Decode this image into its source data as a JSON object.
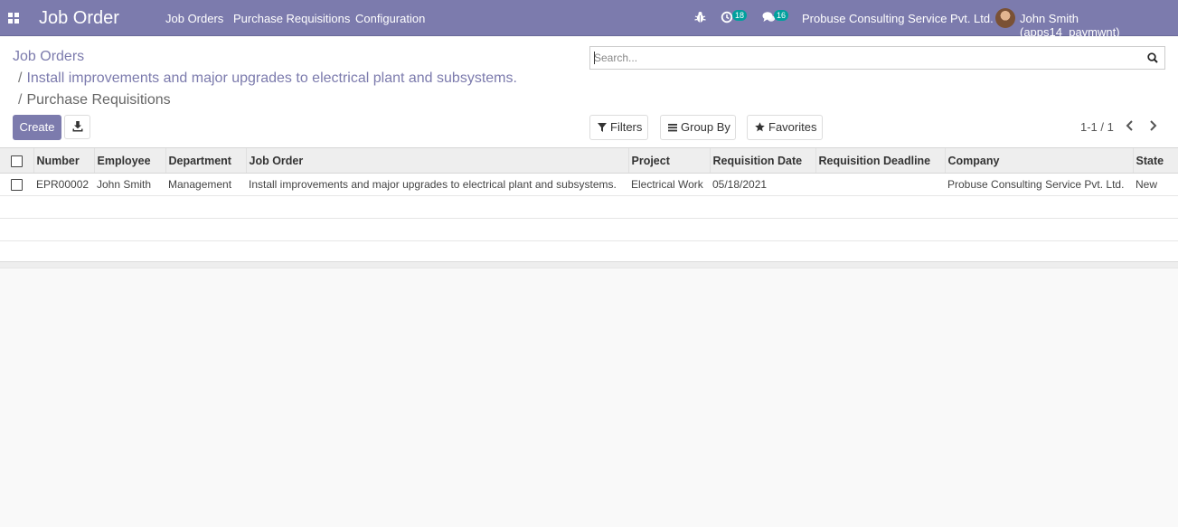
{
  "navbar": {
    "brand": "Job Order",
    "menus": [
      "Job Orders",
      "Purchase Requisitions",
      "Configuration"
    ],
    "activity_count": "18",
    "message_count": "16",
    "company": "Probuse Consulting Service Pvt. Ltd.",
    "user": "John Smith (apps14_paymwnt)"
  },
  "breadcrumb": {
    "items": [
      "Job Orders",
      "Install improvements and major upgrades to electrical plant and subsystems.",
      "Purchase Requisitions"
    ],
    "separator": "/"
  },
  "search": {
    "placeholder": "Search..."
  },
  "buttons": {
    "create": "Create",
    "filters": "Filters",
    "group_by": "Group By",
    "favorites": "Favorites"
  },
  "pager": {
    "value": "1-1 / 1"
  },
  "table": {
    "columns": [
      "Number",
      "Employee",
      "Department",
      "Job Order",
      "Project",
      "Requisition Date",
      "Requisition Deadline",
      "Company",
      "State"
    ],
    "rows": [
      [
        "EPR00002",
        "John Smith",
        "Management",
        "Install improvements and major upgrades to electrical plant and subsystems.",
        "Electrical Work",
        "05/18/2021",
        "",
        "Probuse Consulting Service Pvt. Ltd.",
        "New"
      ]
    ]
  },
  "colors": {
    "navbar": "#7c7bad",
    "badge": "#00a09d",
    "background": "#f9f9f9"
  }
}
